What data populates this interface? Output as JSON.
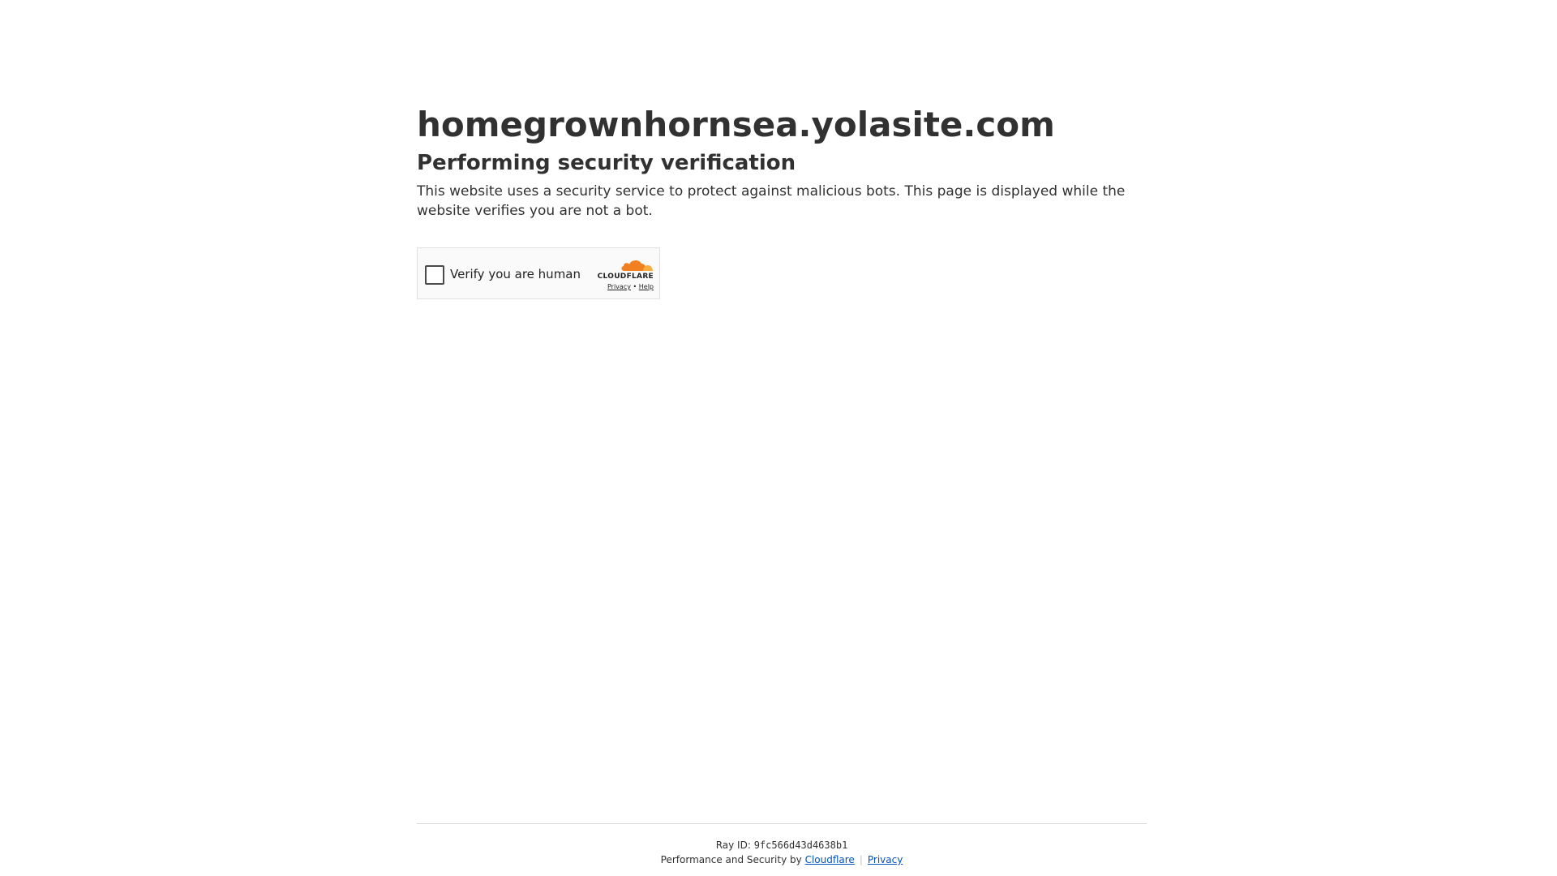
{
  "page": {
    "site_title": "homegrownhornsea.yolasite.com",
    "subtitle": "Performing security verification",
    "description": "This website uses a security service to protect against malicious bots. This page is displayed while the website verifies you are not a bot."
  },
  "challenge_widget": {
    "checkbox_label": "Verify you are human",
    "checkbox_checked": false,
    "brand_wordmark": "CLOUDFLARE",
    "privacy_link": "Privacy",
    "link_separator": "•",
    "help_link": "Help"
  },
  "footer": {
    "ray_id_label": "Ray ID:",
    "ray_id_value": "9fc566d43d4638b1",
    "performance_text": "Performance and Security by",
    "cloudflare_link": "Cloudflare",
    "separator": "|",
    "privacy_link": "Privacy"
  },
  "colors": {
    "text": "#313131",
    "link": "#0051c3",
    "cloudflare_orange": "#f38020",
    "cloudflare_light_orange": "#faae40",
    "widget_background": "#fafafa",
    "widget_border": "#e0e0e0"
  },
  "icons": {
    "brand_logo": "cloudflare-cloud-icon"
  }
}
